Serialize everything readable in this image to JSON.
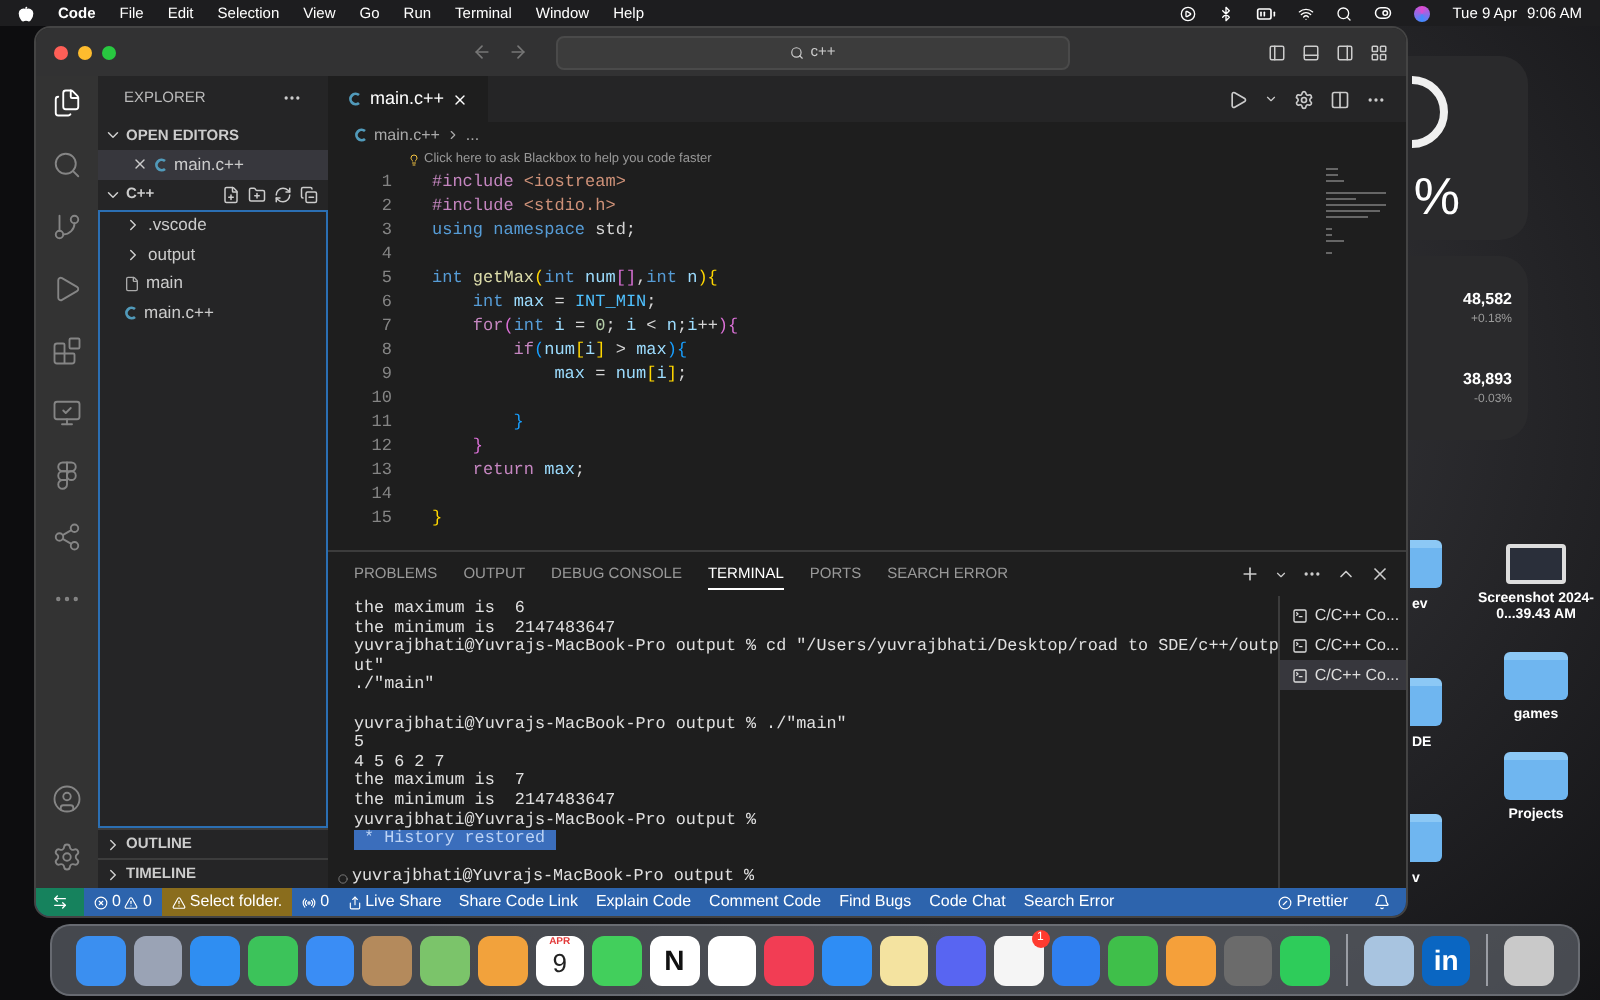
{
  "menu_bar": {
    "app": "Code",
    "items": [
      "File",
      "Edit",
      "Selection",
      "View",
      "Go",
      "Run",
      "Terminal",
      "Window",
      "Help"
    ],
    "date": "Tue 9 Apr",
    "time": "9:06 AM"
  },
  "window": {
    "search": "c++"
  },
  "activity_bar": [
    {
      "kind": "files",
      "selected": true
    },
    {
      "kind": "search",
      "selected": false
    },
    {
      "kind": "source-control",
      "selected": false
    },
    {
      "kind": "run",
      "selected": false
    },
    {
      "kind": "extensions",
      "selected": false
    },
    {
      "kind": "remote",
      "selected": false
    },
    {
      "kind": "figma",
      "selected": false
    },
    {
      "kind": "share",
      "selected": false
    },
    {
      "kind": "more",
      "selected": false
    }
  ],
  "sidebar": {
    "title": "EXPLORER",
    "sections": [
      {
        "title": "OPEN EDITORS",
        "expanded": true,
        "items": [
          {
            "name": "main.c++",
            "kind": "open-editor"
          }
        ]
      },
      {
        "title": "C++",
        "expanded": true,
        "items": [
          {
            "name": ".vscode",
            "kind": "folder",
            "expanded": false
          },
          {
            "name": "output",
            "kind": "folder",
            "expanded": false
          },
          {
            "name": "main",
            "kind": "binary"
          },
          {
            "name": "main.c++",
            "kind": "cpp"
          }
        ]
      }
    ],
    "bottom_sections": [
      {
        "title": "OUTLINE",
        "expanded": false
      },
      {
        "title": "TIMELINE",
        "expanded": false
      }
    ]
  },
  "editor": {
    "tabs": [
      {
        "label": "main.c++",
        "selected": true
      }
    ],
    "breadcrumb": [
      "main.c++",
      "..."
    ],
    "hint": "Click here to ask Blackbox to help you code faster",
    "lines": [
      {
        "number": "1",
        "tokens": [
          {
            "kind": "pp",
            "text": "#include"
          },
          {
            "kind": "str",
            "text": " <iostream>"
          }
        ]
      },
      {
        "number": "2",
        "tokens": [
          {
            "kind": "pp",
            "text": "#include"
          },
          {
            "kind": "str",
            "text": " <stdio.h>"
          }
        ]
      },
      {
        "number": "3",
        "tokens": [
          {
            "kind": "kw",
            "text": "using"
          },
          {
            "kind": "kw",
            "text": " namespace"
          },
          {
            "kind": "plain",
            "text": " std;"
          }
        ]
      },
      {
        "number": "4"
      },
      {
        "number": "5",
        "tokens": [
          {
            "kind": "kw",
            "text": "int"
          },
          {
            "kind": "fn",
            "text": " getMax"
          },
          {
            "kind": "b1",
            "text": "("
          },
          {
            "kind": "kw",
            "text": "int"
          },
          {
            "kind": "var",
            "text": " num"
          },
          {
            "kind": "b2",
            "text": "[]"
          },
          {
            "kind": "plain",
            "text": ","
          },
          {
            "kind": "kw",
            "text": "int"
          },
          {
            "kind": "var",
            "text": " n"
          },
          {
            "kind": "b1",
            "text": "){"
          }
        ]
      },
      {
        "number": "6",
        "tokens": [
          {
            "kind": "kw",
            "text": "    int"
          },
          {
            "kind": "var",
            "text": " max"
          },
          {
            "kind": "plain",
            "text": " = "
          },
          {
            "kind": "const",
            "text": "INT_MIN"
          },
          {
            "kind": "plain",
            "text": ";"
          }
        ]
      },
      {
        "number": "7",
        "tokens": [
          {
            "kind": "ctl",
            "text": "    for"
          },
          {
            "kind": "b2",
            "text": "("
          },
          {
            "kind": "kw",
            "text": "int"
          },
          {
            "kind": "var",
            "text": " i"
          },
          {
            "kind": "plain",
            "text": " = "
          },
          {
            "kind": "num",
            "text": "0"
          },
          {
            "kind": "plain",
            "text": "; "
          },
          {
            "kind": "var",
            "text": "i"
          },
          {
            "kind": "plain",
            "text": " < "
          },
          {
            "kind": "var",
            "text": "n"
          },
          {
            "kind": "plain",
            "text": ";"
          },
          {
            "kind": "var",
            "text": "i"
          },
          {
            "kind": "plain",
            "text": "++"
          },
          {
            "kind": "b2",
            "text": "){"
          }
        ]
      },
      {
        "number": "8",
        "tokens": [
          {
            "kind": "ctl",
            "text": "        if"
          },
          {
            "kind": "b3",
            "text": "("
          },
          {
            "kind": "var",
            "text": "num"
          },
          {
            "kind": "b1",
            "text": "["
          },
          {
            "kind": "var",
            "text": "i"
          },
          {
            "kind": "b1",
            "text": "]"
          },
          {
            "kind": "plain",
            "text": " > "
          },
          {
            "kind": "var",
            "text": "max"
          },
          {
            "kind": "b3",
            "text": "){"
          }
        ]
      },
      {
        "number": "9",
        "tokens": [
          {
            "kind": "var",
            "text": "            max"
          },
          {
            "kind": "plain",
            "text": " = "
          },
          {
            "kind": "var",
            "text": "num"
          },
          {
            "kind": "b1",
            "text": "["
          },
          {
            "kind": "var",
            "text": "i"
          },
          {
            "kind": "b1",
            "text": "]"
          },
          {
            "kind": "plain",
            "text": ";"
          }
        ]
      },
      {
        "number": "10"
      },
      {
        "number": "11",
        "tokens": [
          {
            "kind": "b3",
            "text": "        }"
          }
        ]
      },
      {
        "number": "12",
        "tokens": [
          {
            "kind": "b2",
            "text": "    }"
          }
        ]
      },
      {
        "number": "13",
        "tokens": [
          {
            "kind": "ctl",
            "text": "    return"
          },
          {
            "kind": "var",
            "text": " max"
          },
          {
            "kind": "plain",
            "text": ";"
          }
        ]
      },
      {
        "number": "14"
      },
      {
        "number": "15",
        "tokens": [
          {
            "kind": "b1",
            "text": "}"
          }
        ]
      }
    ]
  },
  "panel": {
    "tabs": [
      {
        "label": "PROBLEMS",
        "selected": false
      },
      {
        "label": "OUTPUT",
        "selected": false
      },
      {
        "label": "DEBUG CONSOLE",
        "selected": false
      },
      {
        "label": "TERMINAL",
        "selected": true
      },
      {
        "label": "PORTS",
        "selected": false
      },
      {
        "label": "SEARCH ERROR",
        "selected": false
      }
    ],
    "terminal": [
      {
        "kind": "text",
        "text": "the maximum is  6"
      },
      {
        "kind": "text",
        "text": "the minimum is  2147483647"
      },
      {
        "kind": "text",
        "text": "yuvrajbhati@Yuvrajs-MacBook-Pro output % cd \"/Users/yuvrajbhati/Desktop/road to SDE/c++/outp"
      },
      {
        "kind": "text",
        "text": "ut\""
      },
      {
        "kind": "text",
        "text": "./\"main\""
      },
      {
        "kind": "blank"
      },
      {
        "kind": "text",
        "text": "yuvrajbhati@Yuvrajs-MacBook-Pro output % ./\"main\""
      },
      {
        "kind": "text",
        "text": "5"
      },
      {
        "kind": "text",
        "text": "4 5 6 2 7"
      },
      {
        "kind": "text",
        "text": "the maximum is  7"
      },
      {
        "kind": "text",
        "text": "the minimum is  2147483647"
      },
      {
        "kind": "text",
        "text": "yuvrajbhati@Yuvrajs-MacBook-Pro output %"
      },
      {
        "kind": "notice",
        "marker": "*",
        "text": "History restored"
      },
      {
        "kind": "blank"
      },
      {
        "kind": "prompt",
        "text": "yuvrajbhati@Yuvrajs-MacBook-Pro output %"
      }
    ],
    "terminals": [
      {
        "label": "C/C++ Co...",
        "selected": false
      },
      {
        "label": "C/C++ Co...",
        "selected": false
      },
      {
        "label": "C/C++ Co...",
        "selected": true
      }
    ]
  },
  "status_bar": [
    {
      "kind": "remote"
    },
    {
      "kind": "problems",
      "errors": "0",
      "warnings": "0"
    },
    {
      "kind": "warning",
      "text": "Select folder."
    },
    {
      "kind": "ports",
      "text": "0"
    },
    {
      "kind": "liveshare",
      "text": "Live Share"
    },
    {
      "kind": "text",
      "text": "Share Code Link"
    },
    {
      "kind": "text",
      "text": "Explain Code"
    },
    {
      "kind": "text",
      "text": "Comment Code"
    },
    {
      "kind": "text",
      "text": "Find Bugs"
    },
    {
      "kind": "text",
      "text": "Code Chat"
    },
    {
      "kind": "text",
      "text": "Search Error"
    },
    {
      "kind": "prettier",
      "text": "Prettier"
    },
    {
      "kind": "bell"
    }
  ],
  "widgets": {
    "gauge": "%",
    "stocks": [
      {
        "value": "48,582",
        "change": "+0.18%"
      },
      {
        "value": "38,893",
        "change": "-0.03%"
      }
    ]
  },
  "desktop_icons": {
    "partly_hidden": [
      {
        "kind": "folder",
        "label": "ev"
      },
      {
        "kind": "folder",
        "label": "DE"
      },
      {
        "kind": "folder",
        "label": "v"
      }
    ],
    "visible": [
      {
        "kind": "screenshot",
        "label": "Screenshot 2024-0...39.43 AM"
      },
      {
        "kind": "folder",
        "label": "games"
      },
      {
        "kind": "folder",
        "label": "Projects"
      }
    ]
  },
  "dock": [
    {
      "kind": "app",
      "color": "#3b8ff0"
    },
    {
      "kind": "app",
      "color": "#9aa3b5"
    },
    {
      "kind": "app",
      "color": "#2f8ef2"
    },
    {
      "kind": "app",
      "color": "#3cc35a"
    },
    {
      "kind": "app",
      "color": "#3a8df5"
    },
    {
      "kind": "app",
      "color": "#b48a5c"
    },
    {
      "kind": "app",
      "color": "#7bc46a"
    },
    {
      "kind": "app",
      "color": "#f2a23c"
    },
    {
      "kind": "calendar",
      "color": "#ffffff",
      "month": "APR",
      "day": "9"
    },
    {
      "kind": "app",
      "color": "#42cf5c"
    },
    {
      "kind": "letter",
      "color": "#ffffff",
      "text": "N"
    },
    {
      "kind": "app",
      "color": "#ffffff"
    },
    {
      "kind": "app",
      "color": "#f23d54"
    },
    {
      "kind": "app",
      "color": "#2e8df5"
    },
    {
      "kind": "app",
      "color": "#f4e3a0"
    },
    {
      "kind": "app",
      "color": "#5865f2"
    },
    {
      "kind": "app",
      "color": "#f5f5f5",
      "badge": "1"
    },
    {
      "kind": "app",
      "color": "#2f7ff0"
    },
    {
      "kind": "app",
      "color": "#3fbf4a"
    },
    {
      "kind": "app",
      "color": "#f5a03a"
    },
    {
      "kind": "app",
      "color": "#6b6b6b"
    },
    {
      "kind": "app",
      "color": "#2ecc5a"
    },
    {
      "kind": "separator"
    },
    {
      "kind": "app",
      "color": "#a8c4e0"
    },
    {
      "kind": "letter",
      "color": "#0a66c2",
      "text": "in"
    },
    {
      "kind": "separator"
    },
    {
      "kind": "app",
      "color": "#c9c9c9"
    }
  ]
}
